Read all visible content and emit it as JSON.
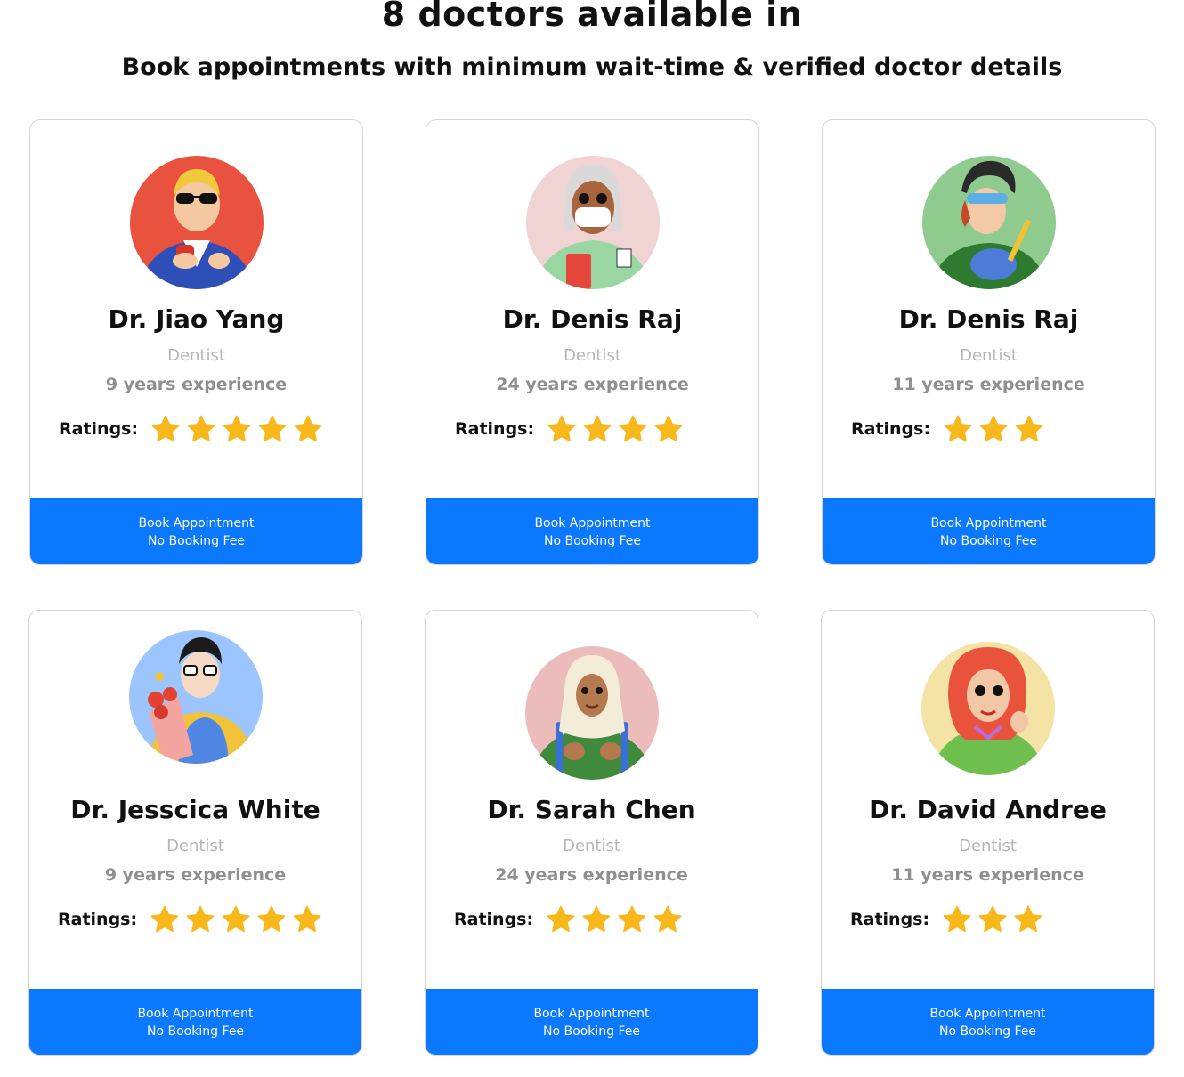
{
  "header": {
    "title": "8 doctors available in",
    "subtitle": "Book appointments with minimum wait-time & verified doctor details"
  },
  "common": {
    "ratings_label": "Ratings:",
    "book_label": "Book Appointment",
    "fee_label": "No Booking Fee"
  },
  "doctors": [
    {
      "name": "Dr. Jiao Yang",
      "specialty": "Dentist",
      "experience": "9 years experience",
      "rating": 5,
      "avatar_icon": "doctor-avatar-sunglasses-icon",
      "avatar_bg": "#e8523f"
    },
    {
      "name": "Dr. Denis Raj",
      "specialty": "Dentist",
      "experience": "24 years experience",
      "rating": 4,
      "avatar_icon": "doctor-avatar-mask-icon",
      "avatar_bg": "#f0d3d3"
    },
    {
      "name": "Dr. Denis Raj",
      "specialty": "Dentist",
      "experience": "11 years experience",
      "rating": 3,
      "avatar_icon": "doctor-avatar-welder-icon",
      "avatar_bg": "#8fcb8e"
    },
    {
      "name": "Dr. Jesscica White",
      "specialty": "Dentist",
      "experience": "9 years experience",
      "rating": 5,
      "avatar_icon": "doctor-avatar-flowers-icon",
      "avatar_bg": "#9cc4ff"
    },
    {
      "name": "Dr. Sarah Chen",
      "specialty": "Dentist",
      "experience": "24 years experience",
      "rating": 4,
      "avatar_icon": "doctor-avatar-hijab-icon",
      "avatar_bg": "#ecbcbc"
    },
    {
      "name": "Dr. David Andree",
      "specialty": "Dentist",
      "experience": "11 years experience",
      "rating": 3,
      "avatar_icon": "doctor-avatar-redhair-icon",
      "avatar_bg": "#f3e3a4"
    }
  ],
  "colors": {
    "accent": "#0a78ff",
    "star": "#f8b81c",
    "muted": "#8f8f8f",
    "border": "#d5d5d5"
  }
}
